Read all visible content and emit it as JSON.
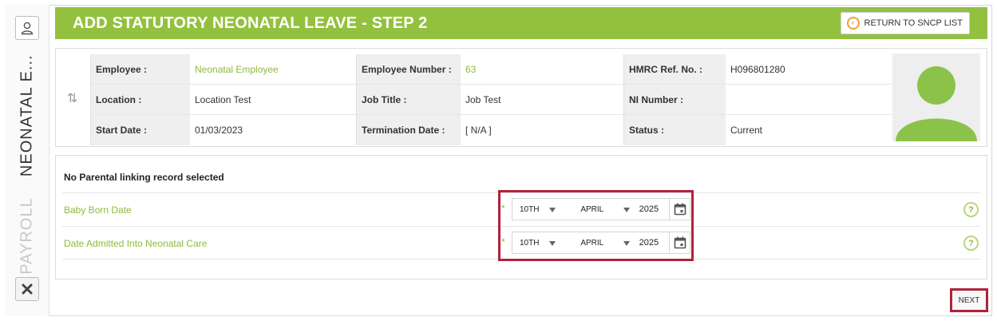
{
  "sidebar": {
    "vertical_muted": "PAYROLL",
    "vertical_title": "NEONATAL E..."
  },
  "header": {
    "title": "ADD STATUTORY NEONATAL LEAVE - STEP 2",
    "return_label": "RETURN TO SNCP LIST"
  },
  "employee": {
    "rows": [
      [
        {
          "label": "Employee :",
          "value": "Neonatal Employee",
          "highlight": true
        },
        {
          "label": "Employee Number :",
          "value": "63",
          "highlight": true
        },
        {
          "label": "HMRC Ref. No. :",
          "value": "H096801280",
          "highlight": false
        }
      ],
      [
        {
          "label": "Location :",
          "value": "Location Test",
          "highlight": false
        },
        {
          "label": "Job Title :",
          "value": "Job Test",
          "highlight": false
        },
        {
          "label": "NI Number :",
          "value": "",
          "highlight": false
        }
      ],
      [
        {
          "label": "Start Date :",
          "value": "01/03/2023",
          "highlight": false
        },
        {
          "label": "Termination Date :",
          "value": "[ N/A ]",
          "highlight": false
        },
        {
          "label": "Status :",
          "value": "Current",
          "highlight": false
        }
      ]
    ]
  },
  "form": {
    "heading": "No Parental linking record selected",
    "required_mark": "*",
    "help_mark": "?",
    "fields": [
      {
        "label": "Baby Born Date",
        "day": "10TH",
        "month": "APRIL",
        "year": "2025"
      },
      {
        "label": "Date Admitted Into Neonatal Care",
        "day": "10TH",
        "month": "APRIL",
        "year": "2025"
      }
    ]
  },
  "footer": {
    "next_label": "NEXT"
  },
  "colors": {
    "brand_green": "#93c13f",
    "label_green": "#8fba3c",
    "highlight_red": "#b0223a",
    "return_icon": "#e8a33a"
  },
  "icons": {
    "user": "user-icon",
    "close": "close-icon",
    "swap": "swap-vertical-icon",
    "return": "chevron-left-circle-icon",
    "calendar": "calendar-icon",
    "help": "help-icon",
    "avatar": "person-silhouette-icon"
  }
}
